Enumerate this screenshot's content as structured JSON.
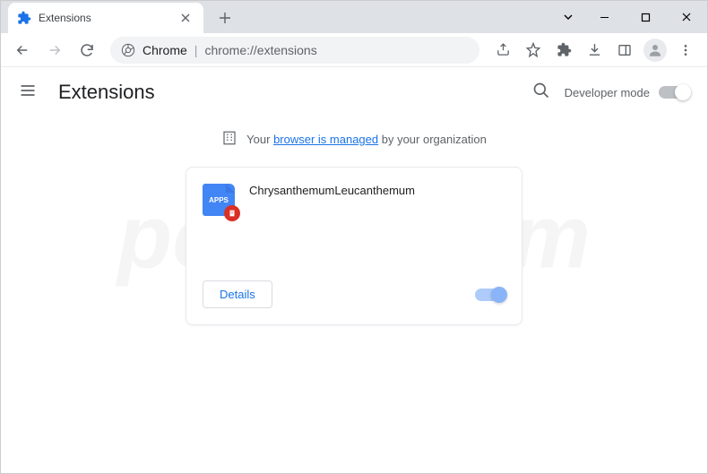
{
  "tab": {
    "title": "Extensions"
  },
  "omnibox": {
    "prefix": "Chrome",
    "url": "chrome://extensions"
  },
  "page": {
    "title": "Extensions",
    "dev_mode_label": "Developer mode"
  },
  "managed": {
    "prefix": "Your ",
    "link": "browser is managed",
    "suffix": " by your organization"
  },
  "extension": {
    "name": "ChrysanthemumLeucanthemum",
    "icon_label": "APPS",
    "details_label": "Details",
    "enabled": true
  },
  "watermark": "pcrisk.com"
}
